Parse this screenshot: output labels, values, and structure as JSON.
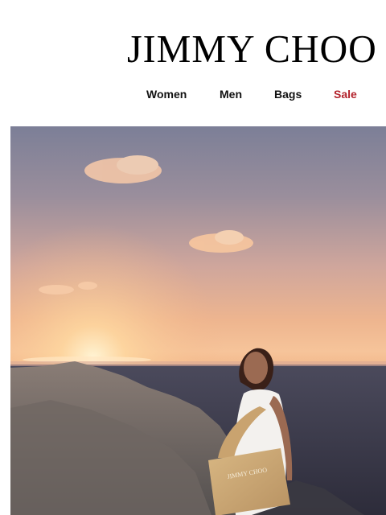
{
  "brand": {
    "logo_text": "JIMMY CHOO"
  },
  "nav": {
    "items": [
      {
        "label": "Women"
      },
      {
        "label": "Men"
      },
      {
        "label": "Bags"
      },
      {
        "label": "Sale"
      }
    ],
    "sale_color": "#b3222b"
  },
  "hero": {
    "bag_logo_text": "JIMMY CHOO"
  }
}
